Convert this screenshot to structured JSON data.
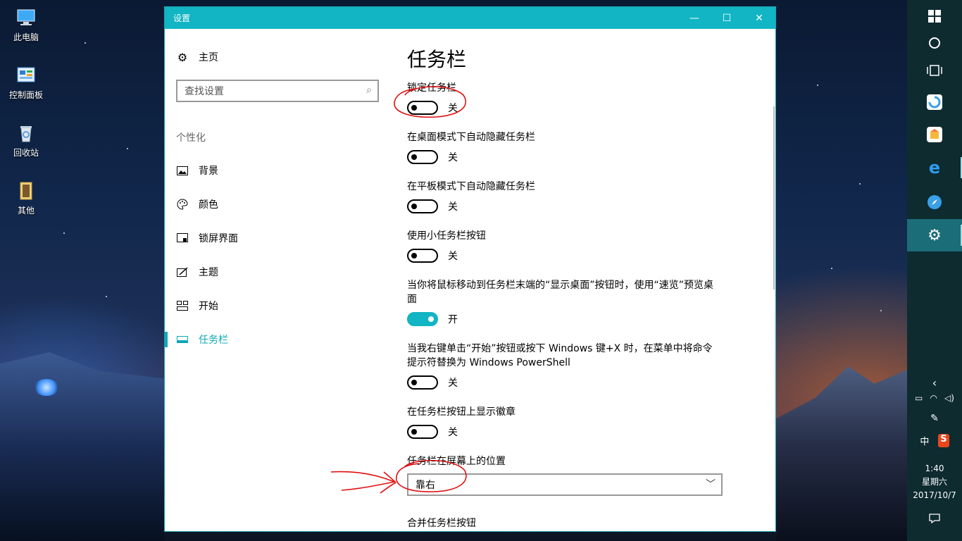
{
  "desktop": {
    "icons": [
      {
        "label": "此电脑",
        "icon": "computer-icon"
      },
      {
        "label": "控制面板",
        "icon": "control-panel-icon"
      },
      {
        "label": "回收站",
        "icon": "recycle-bin-icon"
      },
      {
        "label": "其他",
        "icon": "folder-icon"
      }
    ]
  },
  "window": {
    "title": "设置",
    "controls": {
      "minimize": "—",
      "maximize": "☐",
      "close": "✕"
    }
  },
  "nav": {
    "home": "主页",
    "search_placeholder": "查找设置",
    "section": "个性化",
    "items": [
      {
        "label": "背景",
        "icon": "picture-icon"
      },
      {
        "label": "颜色",
        "icon": "palette-icon"
      },
      {
        "label": "锁屏界面",
        "icon": "lock-screen-icon"
      },
      {
        "label": "主题",
        "icon": "theme-icon"
      },
      {
        "label": "开始",
        "icon": "start-icon"
      },
      {
        "label": "任务栏",
        "icon": "taskbar-icon"
      }
    ]
  },
  "content": {
    "title": "任务栏",
    "settings": [
      {
        "label": "锁定任务栏",
        "state": "关",
        "on": false
      },
      {
        "label": "在桌面模式下自动隐藏任务栏",
        "state": "关",
        "on": false
      },
      {
        "label": "在平板模式下自动隐藏任务栏",
        "state": "关",
        "on": false
      },
      {
        "label": "使用小任务栏按钮",
        "state": "关",
        "on": false
      },
      {
        "label": "当你将鼠标移动到任务栏末端的“显示桌面”按钮时，使用“速览”预览桌面",
        "state": "开",
        "on": true
      },
      {
        "label": "当我右键单击“开始”按钮或按下 Windows 键+X 时，在菜单中将命令提示符替换为 Windows PowerShell",
        "state": "关",
        "on": false
      },
      {
        "label": "在任务栏按钮上显示徽章",
        "state": "关",
        "on": false
      }
    ],
    "position_label": "任务栏在屏幕上的位置",
    "position_value": "靠右",
    "combine_label": "合并任务栏按钮"
  },
  "taskbar": {
    "clock_time": "1:40",
    "clock_day": "星期六",
    "clock_date": "2017/10/7",
    "ime_label": "中",
    "sogou_label": "S"
  },
  "colors": {
    "accent": "#11b5c4",
    "annotation": "#e01010",
    "taskbar": "#0e2b30"
  }
}
